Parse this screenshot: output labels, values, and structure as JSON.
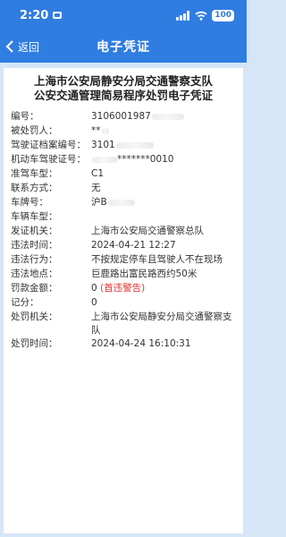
{
  "status_bar": {
    "time": "2:20",
    "battery": "100"
  },
  "nav": {
    "back_label": "返回",
    "title": "电子凭证"
  },
  "document": {
    "title_line1": "上海市公安局静安分局交通警察支队",
    "title_line2": "公安交通管理简易程序处罚电子凭证",
    "rows": {
      "number": {
        "label": "编号：",
        "value": "3106001987"
      },
      "person": {
        "label": "被处罚人：",
        "value": "**"
      },
      "archive": {
        "label": "驾驶证档案编号：",
        "value": "3101"
      },
      "license": {
        "label": "机动车驾驶证号：",
        "value": "*******0010"
      },
      "vehicle_class": {
        "label": "准驾车型：",
        "value": "C1"
      },
      "contact": {
        "label": "联系方式：",
        "value": "无"
      },
      "plate": {
        "label": "车牌号：",
        "value": "沪B"
      },
      "vehicle_type": {
        "label": "车辆车型：",
        "value": ""
      },
      "issuer": {
        "label": "发证机关：",
        "value": "上海市公安局交通警察总队"
      },
      "violation_time": {
        "label": "违法时间：",
        "value": "2024-04-21 12:27"
      },
      "violation_act": {
        "label": "违法行为：",
        "value": "不按规定停车且驾驶人不在现场"
      },
      "violation_place": {
        "label": "违法地点：",
        "value": "巨鹿路出富民路西约50米"
      },
      "fine": {
        "label": "罚款金额：",
        "value": "0",
        "note": "(首违警告)"
      },
      "points": {
        "label": "记分：",
        "value": "0"
      },
      "authority": {
        "label": "处罚机关：",
        "value": "上海市公安局静安分局交通警察支队"
      },
      "penalty_time": {
        "label": "处罚时间：",
        "value": "2024-04-24 16:10:31"
      }
    }
  },
  "colors": {
    "header": "#2f7de1",
    "background": "#d6e6f7",
    "accent_red": "#e0312e"
  },
  "icons": [
    "moon-icon",
    "signal-icon",
    "wifi-icon",
    "battery-icon",
    "back-chevron-icon"
  ]
}
